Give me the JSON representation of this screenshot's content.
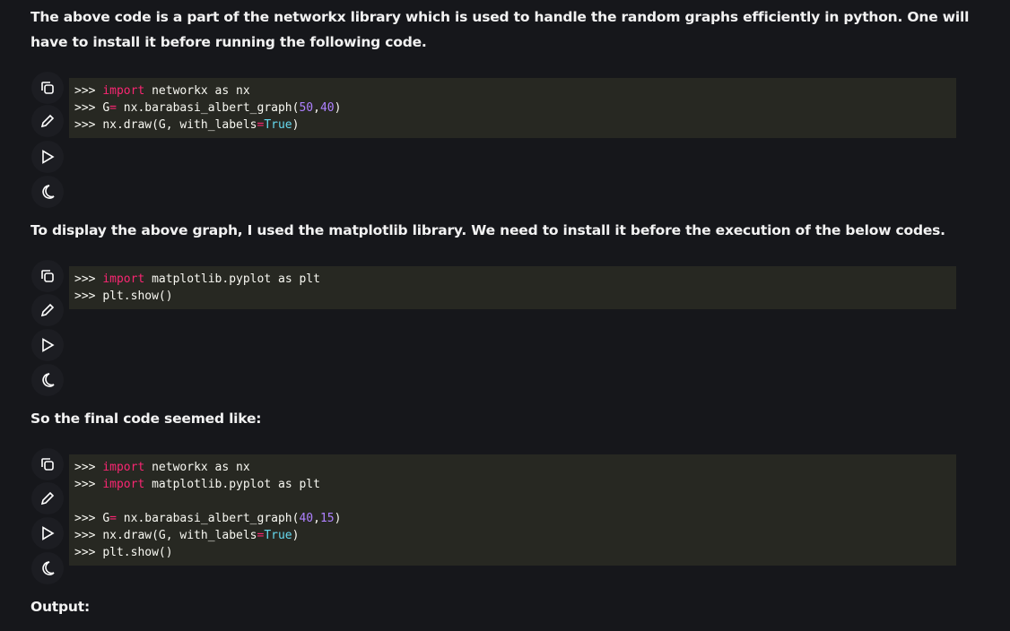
{
  "paragraphs": {
    "intro": "The above code is a part of the networkx library which is used to handle the random graphs efficiently in python. One will have to install it before running the following code.",
    "display": "To display the above graph, I used the matplotlib library. We need to install it before the execution of the below codes.",
    "final": "So the final code seemed like:",
    "output": "Output:"
  },
  "tool_icons": [
    "copy-icon",
    "edit-icon",
    "run-icon",
    "theme-toggle-icon"
  ],
  "code_blocks": [
    {
      "lines": [
        {
          "prompt": ">>> ",
          "kw": "import",
          "rest": " networkx as nx"
        },
        {
          "prompt": ">>> ",
          "text1": "G",
          "op": "=",
          "text2": " nx.barabasi_albert_graph(",
          "n1": "50",
          "sep": ",",
          "n2": "40",
          "end": ")"
        },
        {
          "prompt": ">>> ",
          "text1": "nx.draw(G, with_labels",
          "op": "=",
          "const": "True",
          "end": ")"
        }
      ]
    },
    {
      "lines": [
        {
          "prompt": ">>> ",
          "kw": "import",
          "rest": " matplotlib.pyplot as plt"
        },
        {
          "prompt": ">>> ",
          "rest": "plt.show()"
        }
      ]
    },
    {
      "lines": [
        {
          "prompt": ">>> ",
          "kw": "import",
          "rest": " networkx as nx"
        },
        {
          "prompt": ">>> ",
          "kw": "import",
          "rest": " matplotlib.pyplot as plt"
        },
        {
          "prompt": ">>> ",
          "text1": "G",
          "op": "=",
          "text2": " nx.barabasi_albert_graph(",
          "n1": "40",
          "sep": ",",
          "n2": "15",
          "end": ")"
        },
        {
          "prompt": ">>> ",
          "text1": "nx.draw(G, with_labels",
          "op": "=",
          "const": "True",
          "end": ")"
        },
        {
          "prompt": ">>> ",
          "rest": "plt.show()"
        }
      ]
    }
  ],
  "colors": {
    "background": "#16171b",
    "code_background": "#272822",
    "keyword": "#f92672",
    "number": "#ae81ff",
    "constant": "#66d9ef"
  }
}
